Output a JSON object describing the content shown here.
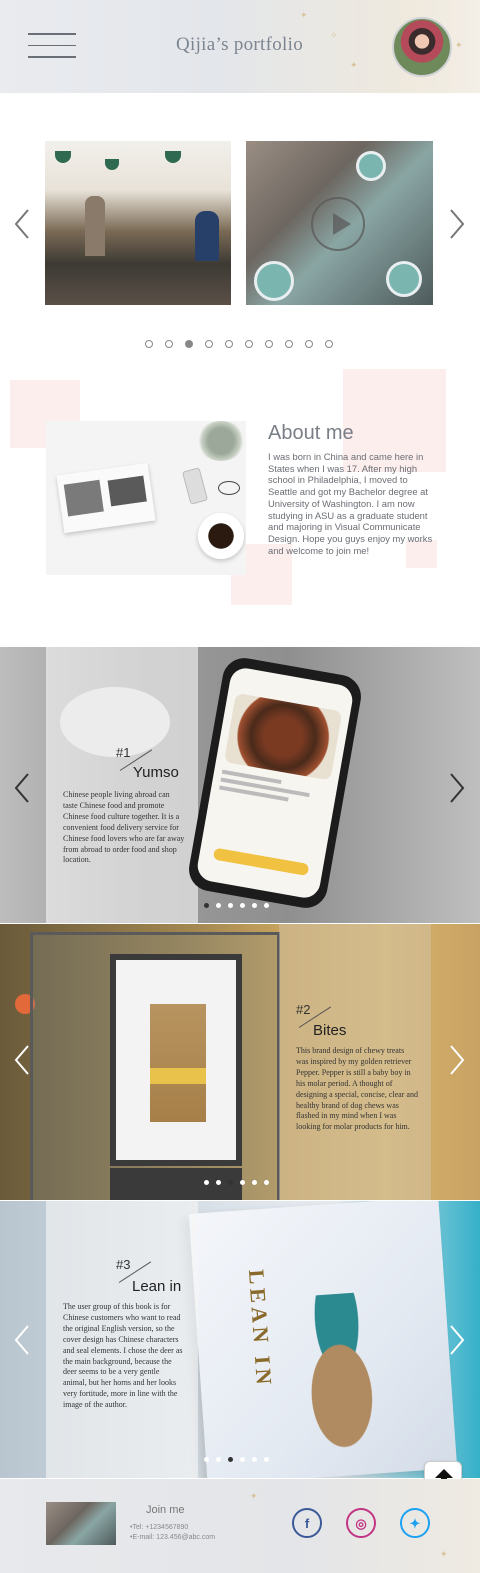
{
  "header": {
    "site_title": "Qijia’s portfolio",
    "menu_icon": "hamburger-menu-icon",
    "avatar": "profile-avatar"
  },
  "gallery": {
    "prev_icon": "chevron-left-icon",
    "next_icon": "chevron-right-icon",
    "play_icon": "play-icon",
    "dot_count": 10,
    "active_dot": 3
  },
  "about": {
    "heading": "About me",
    "body": "I was born in China and came here in States when I was 17. After my high school in Philadelphia, I moved to Seattle and got my Bachelor degree at University of Washington. I am now studying in ASU as a graduate student and majoring in Visual Communicate Design. Hope you guys enjoy my works and welcome to join me!"
  },
  "projects": [
    {
      "number": "#1",
      "name": "Yumso",
      "description": "Chinese people living abroad can taste Chinese food and promote Chinese food culture together. It is a convenient food delivery service for Chinese food lovers who are far away from abroad to order food and shop location.",
      "dots": 6,
      "active_dot": 1
    },
    {
      "number": "#2",
      "name": "Bites",
      "description": "This brand design of chewy treats was inspired by my golden retriever Pepper. Pepper is still a baby boy in his molar period. A thought of designing a special, concise, clear and healthy brand of dog chews was flashed in my mind when I was looking for molar products for him.",
      "dots": 6,
      "active_dot": 3
    },
    {
      "number": "#3",
      "name": "Lean in",
      "description": "The user group of this book is for Chinese customers who want to read the original English version, so the cover design has Chinese characters and seal elements. I chose the deer as the main background, because the deer seems to be a very gentle animal, but her horns and her looks very fortitude, more in line with the image of the author.",
      "dots": 6,
      "active_dot": 3
    }
  ],
  "scroll_top_icon": "arrow-up-icon",
  "footer": {
    "join": "Join me",
    "tel": "•Tel: +1234567890",
    "email": "•E-mail: 123.456@abc.com",
    "social": [
      {
        "name": "facebook-icon",
        "glyph": "f",
        "color": "#3b5998"
      },
      {
        "name": "instagram-icon",
        "glyph": "◎",
        "color": "#c13584"
      },
      {
        "name": "twitter-icon",
        "glyph": "✦",
        "color": "#1da1f2"
      }
    ]
  }
}
